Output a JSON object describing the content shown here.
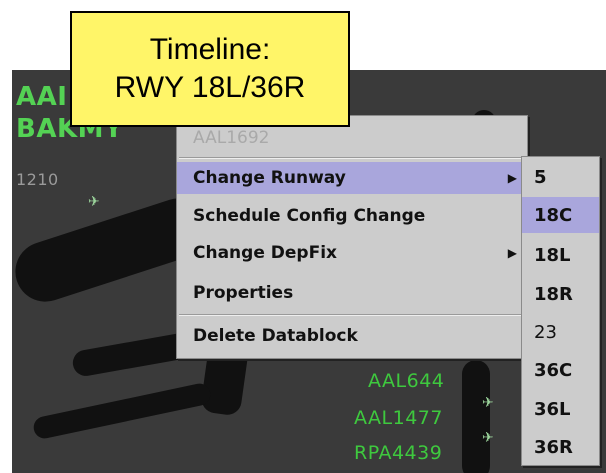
{
  "callout": {
    "line1": "Timeline:",
    "line2": "RWY 18L/36R"
  },
  "radar": {
    "labels": [
      {
        "id": "aal-partial",
        "text": "AAI"
      },
      {
        "id": "bakmy",
        "text": "BAKMY"
      },
      {
        "id": "alt",
        "text": "1210"
      },
      {
        "id": "aal644",
        "text": "AAL644"
      },
      {
        "id": "aal1477",
        "text": "AAL1477"
      },
      {
        "id": "rpa4439",
        "text": "RPA4439"
      }
    ]
  },
  "menu": {
    "header": "AAL1692",
    "items": [
      {
        "label": "Change Runway",
        "submenu": true,
        "selected": true
      },
      {
        "label": "Schedule Config Change",
        "submenu": false,
        "selected": false
      },
      {
        "label": "Change DepFix",
        "submenu": true,
        "selected": false
      },
      {
        "label": "Properties",
        "submenu": false,
        "selected": false
      },
      {
        "label": "Delete Datablock",
        "submenu": false,
        "selected": false
      }
    ]
  },
  "submenu": {
    "items": [
      {
        "label": "5",
        "selected": false
      },
      {
        "label": "18C",
        "selected": true
      },
      {
        "label": "18L",
        "selected": false
      },
      {
        "label": "18R",
        "selected": false
      },
      {
        "label": "23",
        "selected": false
      },
      {
        "label": "36C",
        "selected": false
      },
      {
        "label": "36L",
        "selected": false
      },
      {
        "label": "36R",
        "selected": false
      }
    ]
  },
  "colors": {
    "radar_bg": "#3a3a3a",
    "datablock_green": "#3ec93e",
    "menu_bg": "#cccccc",
    "selection": "#a9a6dc",
    "callout_bg": "#fff568"
  }
}
